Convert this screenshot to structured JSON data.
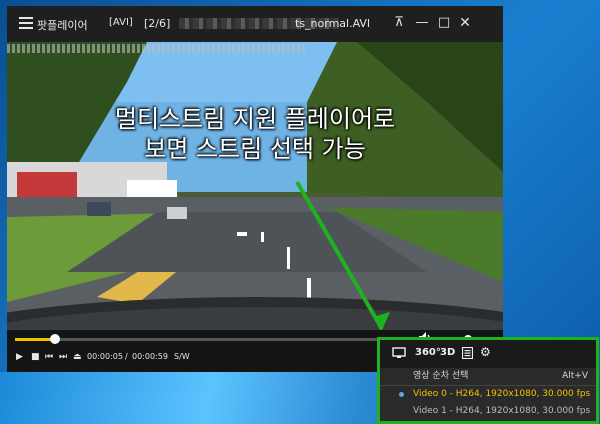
{
  "window": {
    "app_name": "팟플레이어",
    "format_tag": "[AVI]",
    "playlist_position": "[2/6]",
    "file_name_tail": "ts_normal.AVI",
    "buttons": {
      "pin": "⊼",
      "minimize": "—",
      "maximize": "□",
      "close": "✕"
    }
  },
  "video": {
    "caption_line1": "멀티스트림 지원 플레이어로",
    "caption_line2": "보면 스트림 선택 가능"
  },
  "controls": {
    "play": "▶",
    "stop": "■",
    "prev": "⏮",
    "next": "⏭",
    "eject": "⏏",
    "time_current": "00:00:05",
    "time_separator": "/",
    "time_total": "00:00:59",
    "sw_label": "S/W",
    "seek_progress": 0.1,
    "volume_level": 0.85
  },
  "popup": {
    "icons": {
      "screen": "screen-icon",
      "deg360": "360°",
      "threed": "3D",
      "list": "list-icon",
      "settings": "⚙"
    },
    "menu": {
      "header_label": "영상 순차 선택",
      "header_shortcut": "Alt+V",
      "items": [
        {
          "label": "Video 0 - H264, 1920x1080, 30.000 fps",
          "selected": true
        },
        {
          "label": "Video 1 - H264, 1920x1080, 30.000 fps",
          "selected": false
        }
      ]
    }
  },
  "colors": {
    "accent": "#f2c200",
    "highlight_border": "#1fb21f",
    "arrow": "#1fb21f"
  }
}
